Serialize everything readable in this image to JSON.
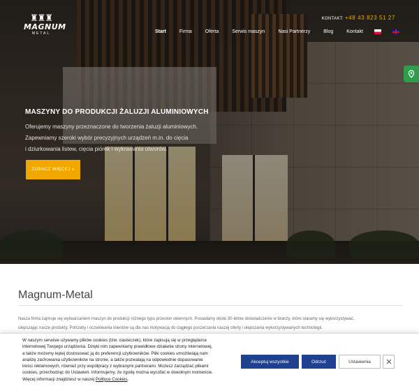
{
  "header": {
    "logo": {
      "word": "MAGNUM",
      "sub": "METAL"
    },
    "contact_label": "KONTAKT:",
    "contact_phone": "+48 43 823 51 27",
    "nav": [
      {
        "label": "Start",
        "active": true
      },
      {
        "label": "Firma"
      },
      {
        "label": "Oferta"
      },
      {
        "label": "Serwis maszyn"
      },
      {
        "label": "Nasi Partnerzy"
      },
      {
        "label": "Blog"
      },
      {
        "label": "Kontakt"
      }
    ],
    "languages": [
      "pl",
      "en"
    ],
    "side_icon": "map-pin-phone-icon"
  },
  "hero": {
    "title": "MASZYNY DO PRODUKCJI ŻALUZJI ALUMINIOWYCH",
    "description_lines": [
      "Oferujemy maszyny przeznaczone do tworzenia żaluzji aluminiowych.",
      "Zapewniamy szeroki wybór precyzyjnych urządzeń m.in. do cięcia",
      "i dziurkowania listew, cięcia piórek i wykrawania otworów."
    ],
    "cta_label": "ZOBACZ WIĘCEJ »"
  },
  "content": {
    "title": "Magnum-Metal",
    "text_lines": [
      "Nasza firma zajmuje się wytwarzaniem maszyn do produkcji różnego typu przesłon okiennych. Posiadamy około 30-letnie doświadczenie w branży, które staramy się wykorzystywać,",
      "ulepszając nasze produkty. Potrzeby i oczekiwania klientów są dla nas motywacją do ciągłego poszerzania naszej oferty i ulepszania wykorzystywanych technologii."
    ]
  },
  "cookie": {
    "lines": [
      "W naszym serwisie używamy plików cookies (tzw. ciasteczek), które zapisują się w przeglądarce",
      "internetowej Twojego urządzenia. Dzięki nim zapewniamy prawidłowe działanie strony internetowej,",
      "a także możemy lepiej dostosować ją do preferencji użytkowników. Pliki cookies umożliwiają nam",
      "analizę zachowania użytkowników na stronie, a także pozwalają na odpowiednie dopasowanie",
      "treści reklamowych, również przy współpracy z wybranymi partnerami. Możesz zarządzać plikami",
      "cookies, przechodząc do Ustawień. Informujemy, że zgodę można wycofać w dowolnym momencie."
    ],
    "last_line_prefix": "Więcej informacji znajdziesz w naszej ",
    "policy_link": "Polityce Cookies",
    "last_line_suffix": ".",
    "accept_label": "Akceptuj wszystkie",
    "reject_label": "Odrzuć",
    "settings_label": "Ustawienia",
    "close_icon": "close-icon"
  }
}
